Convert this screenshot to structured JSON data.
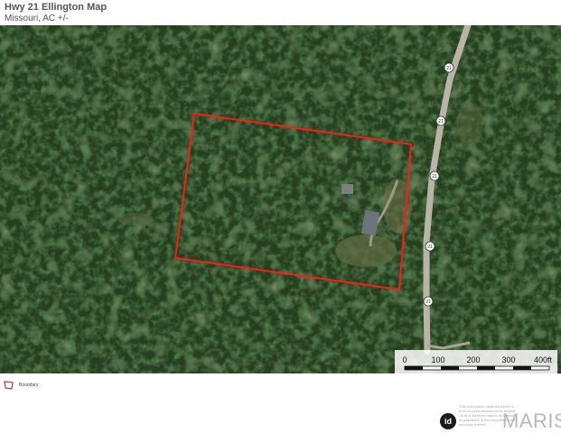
{
  "header": {
    "title": "Hwy 21 Ellington Map",
    "subtitle": "Missouri,  AC +/-"
  },
  "map": {
    "highway_shield": "21",
    "scale_labels": [
      "0",
      "100",
      "200",
      "300",
      "400ft"
    ],
    "colors": {
      "boundary": "#ff1a1a",
      "forest": "#26401f",
      "road": "#b9b4a6"
    }
  },
  "legend": {
    "label": "Boundary"
  },
  "footer": {
    "logo_text": "id",
    "disclaimer": "This information obtained herein is from sources deemed to be reliable. Land id Services makes no warranty or guarantee of the completeness or accuracy thereof.",
    "brand": "MARIS"
  }
}
